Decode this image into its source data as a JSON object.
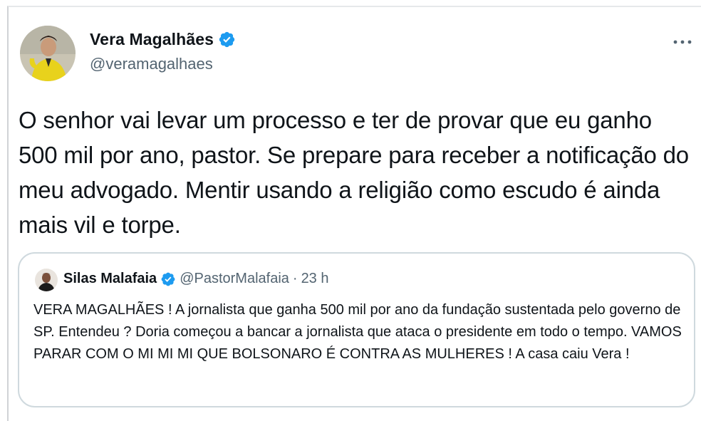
{
  "author": {
    "name": "Vera Magalhães",
    "handle": "@veramagalhaes",
    "verified": true,
    "avatar_icon": "user-photo"
  },
  "menu": {
    "more_glyph": "···"
  },
  "tweet": {
    "text": "O senhor vai levar um processo e ter de provar que eu ganho 500 mil por ano, pastor. Se prepare para receber a notificação do meu advogado. Mentir usando a religião como escudo é ainda mais vil e torpe."
  },
  "quoted_tweet": {
    "author_name": "Silas Malafaia",
    "handle": "@PastorMalafaia",
    "separator": "·",
    "time": "23 h",
    "verified": true,
    "text": "VERA MAGALHÃES ! A jornalista que ganha 500 mil por ano da fundação sustentada pelo governo de SP. Entendeu ? Doria começou a bancar a jornalista que ataca o presidente em todo o tempo. VAMOS PARAR COM O MI MI MI QUE BOLSONARO É CONTRA AS MULHERES ! A casa caiu Vera !"
  },
  "colors": {
    "verified_blue": "#1d9bf0",
    "secondary_text": "#536471",
    "primary_text": "#0f1419",
    "border": "#cfd9de"
  }
}
